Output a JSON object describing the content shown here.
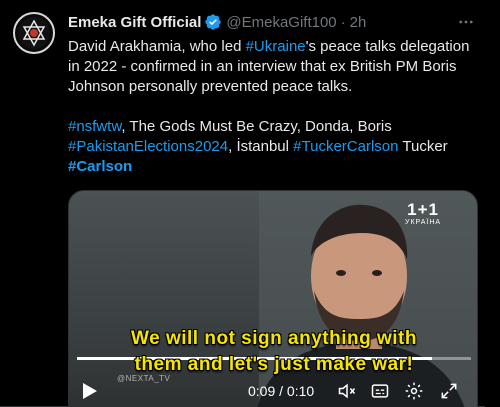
{
  "tweet": {
    "author_name": "Emeka Gift Official",
    "handle": "@EmekaGift100",
    "separator": "·",
    "time": "2h",
    "text_p1": [
      {
        "t": "David Arakhamia, who led ",
        "type": "text"
      },
      {
        "t": "#Ukraine",
        "type": "tag"
      },
      {
        "t": "'s peace talks delegation in 2022 - confirmed in an interview that ex British PM Boris Johnson personally prevented peace talks.",
        "type": "text"
      }
    ],
    "text_p2": [
      {
        "t": "#nsfwtw",
        "type": "tag"
      },
      {
        "t": ", The Gods Must Be Crazy, Donda, Boris ",
        "type": "text"
      },
      {
        "t": "#PakistanElections2024",
        "type": "tag"
      },
      {
        "t": ", İstanbul ",
        "type": "text"
      },
      {
        "t": "#TuckerCarlson",
        "type": "tag"
      },
      {
        "t": " Tucker ",
        "type": "text"
      },
      {
        "t": "#Carlson",
        "type": "tag-bold"
      }
    ]
  },
  "video": {
    "channel_logo": "1+1",
    "channel_sub": "УКРАЇНА",
    "subtitle_line1": "We will not sign anything with",
    "subtitle_line2": "them and let's just make war!",
    "watermark": "@NEXTA_TV",
    "timestamp": "0:09 / 0:10",
    "progress": 0.9
  },
  "colors": {
    "accent": "#1d9bf0",
    "subtitle": "#f5e500",
    "text": "#e7e9ea",
    "muted": "#71767b"
  },
  "icons": [
    "verified-badge-icon",
    "more-icon",
    "play-icon",
    "volume-muted-icon",
    "captions-icon",
    "settings-icon",
    "fullscreen-icon"
  ]
}
